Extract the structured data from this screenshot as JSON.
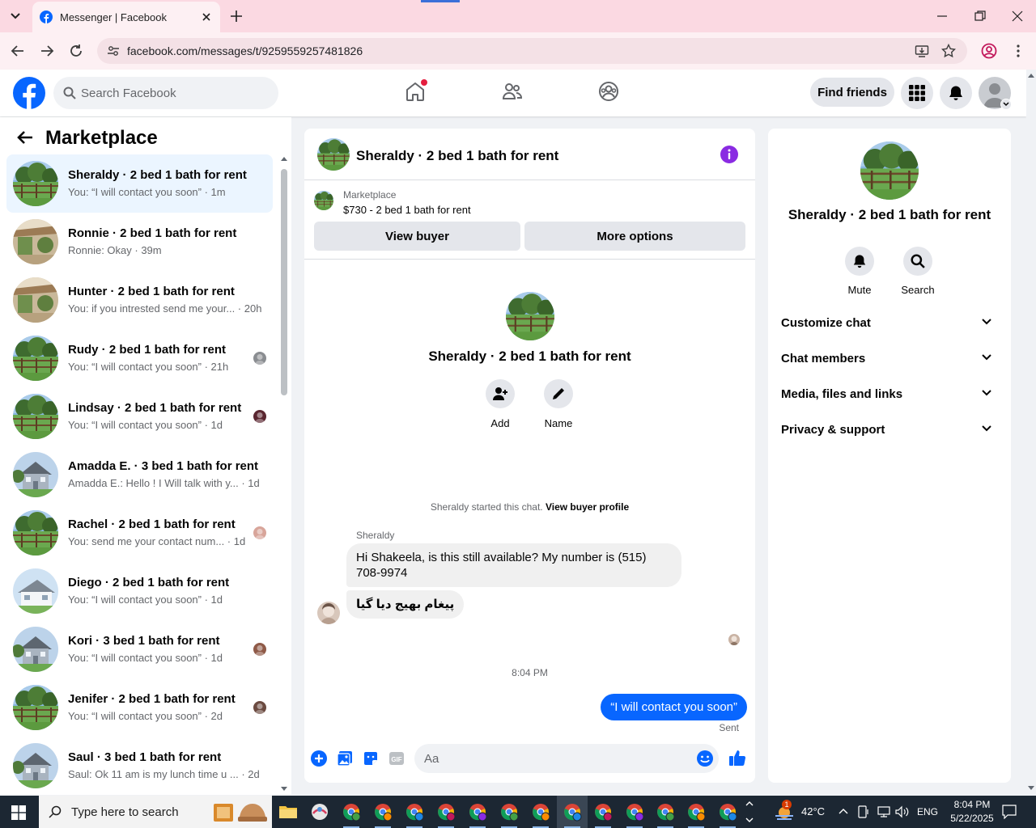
{
  "browser": {
    "tab_title": "Messenger | Facebook",
    "url": "facebook.com/messages/t/9259559257481826"
  },
  "header": {
    "search_placeholder": "Search Facebook",
    "find_friends": "Find friends"
  },
  "sidebar": {
    "title": "Marketplace",
    "conversations": [
      {
        "name": "Sheraldy · 2 bed 1 bath for rent",
        "preview": "You: “I will contact you soon” · 1m",
        "thumb": "yard"
      },
      {
        "name": "Ronnie · 2 bed 1 bath for rent",
        "preview": "Ronnie: Okay · 39m",
        "thumb": "patio"
      },
      {
        "name": "Hunter · 2 bed 1 bath for rent",
        "preview": "You: if you intrested send me your... · 20h",
        "thumb": "patio"
      },
      {
        "name": "Rudy · 2 bed 1 bath for rent",
        "preview": "You: “I will contact you soon” · 21h",
        "thumb": "yard"
      },
      {
        "name": "Lindsay · 2 bed 1 bath for rent",
        "preview": "You: “I will contact you soon” · 1d",
        "thumb": "yard"
      },
      {
        "name": "Amadda E. · 3 bed 1 bath for rent",
        "preview": "Amadda E.: Hello ! I Will talk with y... · 1d",
        "thumb": "house"
      },
      {
        "name": "Rachel · 2 bed 1 bath for rent",
        "preview": "You: send me your contact num... · 1d",
        "thumb": "yard"
      },
      {
        "name": "Diego · 2 bed 1 bath for rent",
        "preview": "You: “I will contact you soon” · 1d",
        "thumb": "whitehouse"
      },
      {
        "name": "Kori · 3 bed 1 bath for rent",
        "preview": "You: “I will contact you soon” · 1d",
        "thumb": "house"
      },
      {
        "name": "Jenifer · 2 bed 1 bath for rent",
        "preview": "You: “I will contact you soon” · 2d",
        "thumb": "yard"
      },
      {
        "name": "Saul · 3 bed 1 bath for rent",
        "preview": "Saul: Ok 11 am is my lunch time u ... · 2d",
        "thumb": "house"
      }
    ]
  },
  "chat": {
    "title": "Sheraldy · 2 bed 1 bath for rent",
    "marketplace_label": "Marketplace",
    "listing": "$730 - 2 bed 1 bath for rent",
    "view_buyer": "View buyer",
    "more_options": "More options",
    "intro_name": "Sheraldy · 2 bed 1 bath for rent",
    "add_label": "Add",
    "name_label": "Name",
    "system_text": "Sheraldy started this chat.",
    "system_link": "View buyer profile",
    "sender": "Sheraldy",
    "incoming_1": "Hi Shakeela, is this still available? My number is (515) 708-9974",
    "incoming_2": "پیغام بھیج دیا گیا",
    "time": "8:04 PM",
    "outgoing": "“I will contact you soon”",
    "status": "Sent",
    "composer_placeholder": "Aa"
  },
  "info": {
    "name": "Sheraldy · 2 bed 1 bath for rent",
    "mute": "Mute",
    "search": "Search",
    "sections": [
      "Customize chat",
      "Chat members",
      "Media, files and links",
      "Privacy & support"
    ]
  },
  "taskbar": {
    "search_placeholder": "Type here to search",
    "weather_badge": "1",
    "temperature": "42°C",
    "language": "ENG",
    "time": "8:04 PM",
    "date": "5/22/2025"
  },
  "colors": {
    "brand": "#0866ff",
    "accent_purple": "#8a2be2",
    "active_row": "#ebf5ff"
  }
}
